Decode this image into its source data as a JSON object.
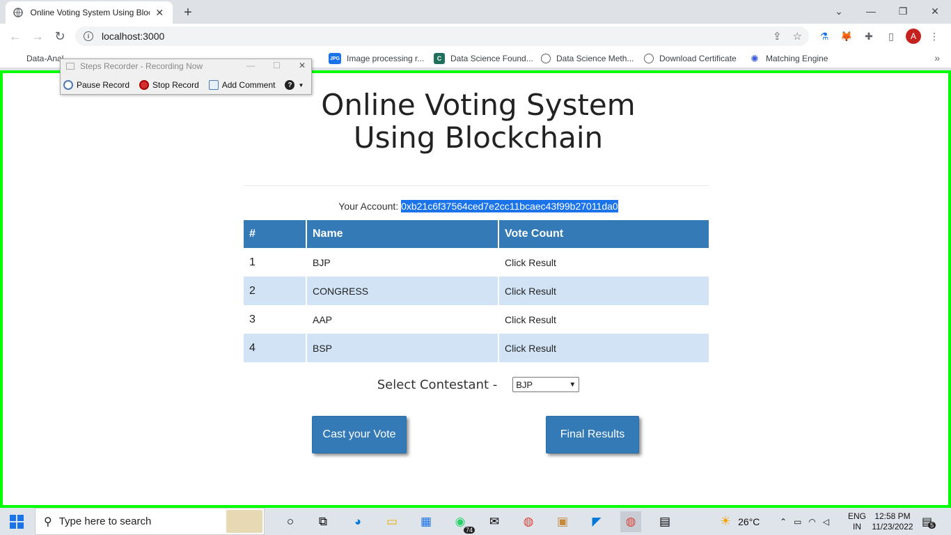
{
  "browser": {
    "tab_title": "Online Voting System Using Bloc",
    "url": "localhost:3000",
    "bookmarks": [
      {
        "label": "Data-Anal",
        "color": "#555"
      },
      {
        "label": "Image processing r...",
        "color": "#1a73e8",
        "icon_text": "JPG"
      },
      {
        "label": "Data Science Found...",
        "color": "#1e6f5c",
        "icon_text": "C"
      },
      {
        "label": "Data Science Meth...",
        "color": "#5f6368"
      },
      {
        "label": "Download Certificate",
        "color": "#5f6368"
      },
      {
        "label": "Matching Engine",
        "color": "#3b5bdb"
      }
    ],
    "profile_initial": "A"
  },
  "recorder": {
    "title": "Steps Recorder - Recording Now",
    "pause_label": "Pause Record",
    "stop_label": "Stop Record",
    "comment_label": "Add Comment",
    "help_label": "?"
  },
  "page": {
    "title_line1": "Online Voting System",
    "title_line2": "Using Blockchain",
    "account_label": "Your Account:",
    "account_value": "0xb21c6f37564ced7e2cc11bcaec43f99b27011da0",
    "table": {
      "headers": [
        "#",
        "Name",
        "Vote Count"
      ],
      "rows": [
        {
          "num": "1",
          "name": "BJP",
          "votes": "Click Result"
        },
        {
          "num": "2",
          "name": "CONGRESS",
          "votes": "Click Result"
        },
        {
          "num": "3",
          "name": "AAP",
          "votes": "Click Result"
        },
        {
          "num": "4",
          "name": "BSP",
          "votes": "Click Result"
        }
      ]
    },
    "select_label": "Select Contestant -",
    "select_value": "BJP",
    "cast_button": "Cast your Vote",
    "results_button": "Final Results"
  },
  "taskbar": {
    "search_placeholder": "Type here to search",
    "whatsapp_badge": "74",
    "temperature": "26°C",
    "lang_top": "ENG",
    "lang_bottom": "IN",
    "time": "12:58 PM",
    "date": "11/23/2022",
    "notification_count": "5"
  }
}
